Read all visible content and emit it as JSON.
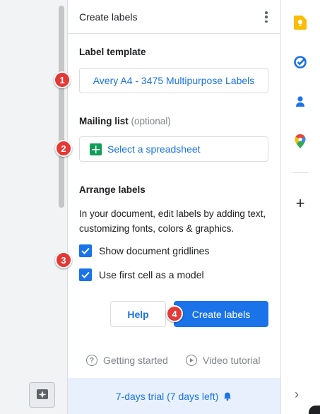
{
  "panel": {
    "title": "Create labels",
    "label_template_heading": "Label template",
    "label_template_value": "Avery A4 - 3475 Multipurpose Labels",
    "mailing_list_heading": "Mailing list",
    "mailing_list_optional": "(optional)",
    "select_spreadsheet": "Select a spreadsheet",
    "arrange_heading": "Arrange labels",
    "arrange_description": "In your document, edit labels by adding text, customizing fonts, colors & graphics.",
    "checkbox_gridlines": "Show document gridlines",
    "checkbox_first_cell": "Use first cell as a model",
    "help_button": "Help",
    "create_button": "Create labels",
    "getting_started": "Getting started",
    "video_tutorial": "Video tutorial",
    "trial_text": "7-days trial (7 days left)"
  },
  "badges": [
    "1",
    "2",
    "3",
    "4"
  ],
  "rail": {
    "icons": [
      "keep-icon",
      "tasks-icon",
      "contacts-icon",
      "maps-icon",
      "add-icon",
      "chevron-right-icon"
    ]
  },
  "colors": {
    "accent": "#1a73e8",
    "badge": "#e53935",
    "sheets_green": "#0f9d58",
    "trial_bg": "#e8f0fe"
  }
}
